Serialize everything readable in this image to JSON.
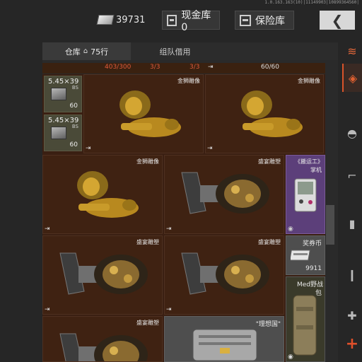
{
  "header": {
    "version": "1.0.163.163(10)|11149903|10899364560|",
    "cash": "39731",
    "cash_storage_label": "现金库 0",
    "insurance_label": "保险库"
  },
  "tabs": {
    "warehouse": "仓库",
    "rows": "75行",
    "team_borrow": "组队借用"
  },
  "strip": {
    "count_a": "403/300",
    "count_b": "3/3",
    "count_c": "3/3",
    "count_d": "60/60"
  },
  "ammo": [
    {
      "caliber": "5.45×39",
      "type": "BS",
      "count": "60"
    },
    {
      "caliber": "5.45×39",
      "type": "BS",
      "count": "60"
    }
  ],
  "items": {
    "lion_1": "金狮雕像",
    "lion_2": "金狮雕像",
    "lion_3": "金狮雕像",
    "skull_1": "盛宴雕塑",
    "skull_2": "盛宴雕塑",
    "skull_3": "盛宴雕塑",
    "skull_4": "盛宴雕塑",
    "handheld_title": "《搬运工》",
    "handheld_sub": "掌机",
    "coupon": "奖券币",
    "coupon_count": "9911",
    "medbag": "Med野战",
    "medbag_sub": "包",
    "case": "\"理想国\""
  },
  "sidebar_icons": [
    "stack-icon",
    "layers-icon",
    "helmet-icon",
    "rifle-icon",
    "magazine-icon",
    "bullet-icon",
    "medkit-icon",
    "plus-icon"
  ]
}
